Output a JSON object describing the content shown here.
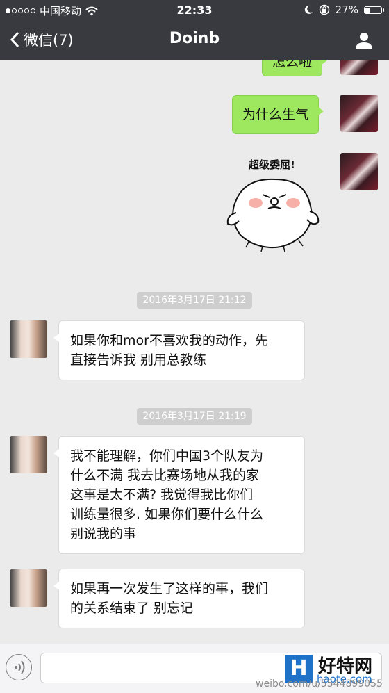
{
  "status_bar": {
    "carrier": "中国移动",
    "time": "22:33",
    "battery": "27%",
    "battery_level": 0.27
  },
  "nav": {
    "back_label": "微信(7)",
    "title": "Doinb"
  },
  "messages": [
    {
      "side": "right",
      "type": "text",
      "text": "怎么啦"
    },
    {
      "side": "right",
      "type": "text",
      "text": "为什么生气"
    },
    {
      "side": "right",
      "type": "sticker",
      "caption": "超级委屈!"
    },
    {
      "type": "timestamp",
      "text": "2016年3月17日 21:12"
    },
    {
      "side": "left",
      "type": "text",
      "lines": [
        "如果你和mor不喜欢我的动作，先",
        "直接告诉我 别用总教练"
      ]
    },
    {
      "type": "timestamp",
      "text": "2016年3月17日 21:19"
    },
    {
      "side": "left",
      "type": "text",
      "lines": [
        "我不能理解，你们中国3个队友为",
        "什么不满 我去比赛场地从我的家",
        "这事是太不满? 我觉得我比你们",
        "训练量很多. 如果你们要什么什么",
        "别说我的事"
      ]
    },
    {
      "side": "left",
      "type": "text",
      "lines": [
        "如果再一次发生了这样的事，我们",
        "的关系结束了 别忘记"
      ]
    }
  ],
  "watermark": {
    "logo": "H",
    "site_name": "好特网",
    "site_url": "haote.com",
    "weibo": "weibo.com/u/5544899055"
  },
  "colors": {
    "bar_bg": "#393a3f",
    "chat_bg": "#ebebeb",
    "green_bubble": "#9ee85f",
    "white_bubble": "#ffffff",
    "timestamp_bg": "#cecece"
  }
}
